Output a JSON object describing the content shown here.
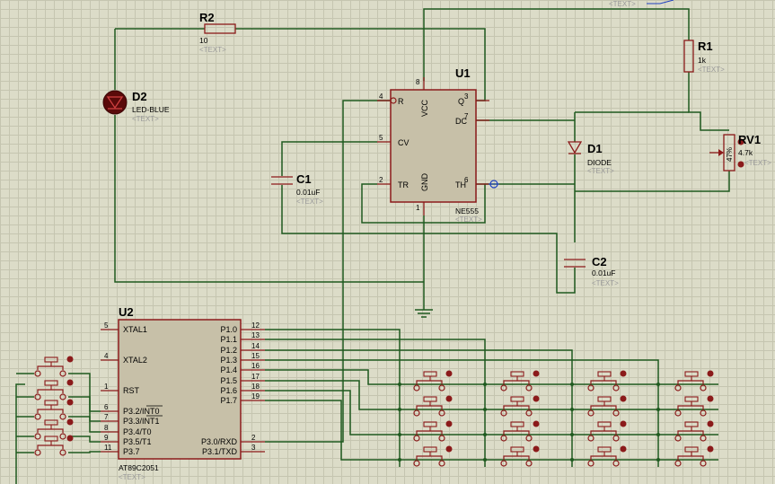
{
  "text_placeholder": "<TEXT>",
  "u1": {
    "ref": "U1",
    "value": "NE555",
    "pin_labels": {
      "r": "R",
      "q": "Q",
      "dc": "DC",
      "cv": "CV",
      "tr": "TR",
      "th": "TH",
      "vcc": "VCC",
      "gnd": "GND"
    },
    "pin_numbers": {
      "r": "4",
      "q": "3",
      "dc": "7",
      "cv": "5",
      "tr": "2",
      "th": "6",
      "vcc": "8",
      "gnd": "1"
    }
  },
  "r1": {
    "ref": "R1",
    "value": "1k"
  },
  "r2": {
    "ref": "R2",
    "value": "10"
  },
  "rv1": {
    "ref": "RV1",
    "value": "4.7k",
    "body_label": "47%"
  },
  "d1": {
    "ref": "D1",
    "value": "DIODE"
  },
  "d2": {
    "ref": "D2",
    "value": "LED-BLUE"
  },
  "c1": {
    "ref": "C1",
    "value": "0.01uF"
  },
  "c2": {
    "ref": "C2",
    "value": "0.01uF"
  },
  "u2": {
    "ref": "U2",
    "value": "AT89C2051",
    "left_pins": [
      {
        "label": "XTAL1",
        "num": "5"
      },
      {
        "label": "XTAL2",
        "num": "4"
      },
      {
        "label": "RST",
        "num": "1"
      },
      {
        "label": "P3.2/INT0",
        "num": "6"
      },
      {
        "label": "P3.3/INT1",
        "num": "7"
      },
      {
        "label": "P3.4/T0",
        "num": "8"
      },
      {
        "label": "P3.5/T1",
        "num": "9"
      },
      {
        "label": "P3.7",
        "num": "11"
      }
    ],
    "right_pins": [
      {
        "label": "P1.0",
        "num": "12"
      },
      {
        "label": "P1.1",
        "num": "13"
      },
      {
        "label": "P1.2",
        "num": "14"
      },
      {
        "label": "P1.3",
        "num": "15"
      },
      {
        "label": "P1.4",
        "num": "16"
      },
      {
        "label": "P1.5",
        "num": "17"
      },
      {
        "label": "P1.6",
        "num": "18"
      },
      {
        "label": "P1.7",
        "num": "19"
      },
      {
        "label": "P3.0/RXD",
        "num": "2"
      },
      {
        "label": "P3.1/TXD",
        "num": "3"
      }
    ]
  },
  "keypad": {
    "rows": 4,
    "cols": 4
  },
  "side_buttons": {
    "count": 5
  },
  "colors": {
    "wire": "#1f5a1f",
    "component": "#8b1a1a",
    "grid_bg": "#dcdcc8",
    "grid_line": "#c5c5b0",
    "placeholder": "#9a9a9a",
    "probe": "#2040c0"
  }
}
